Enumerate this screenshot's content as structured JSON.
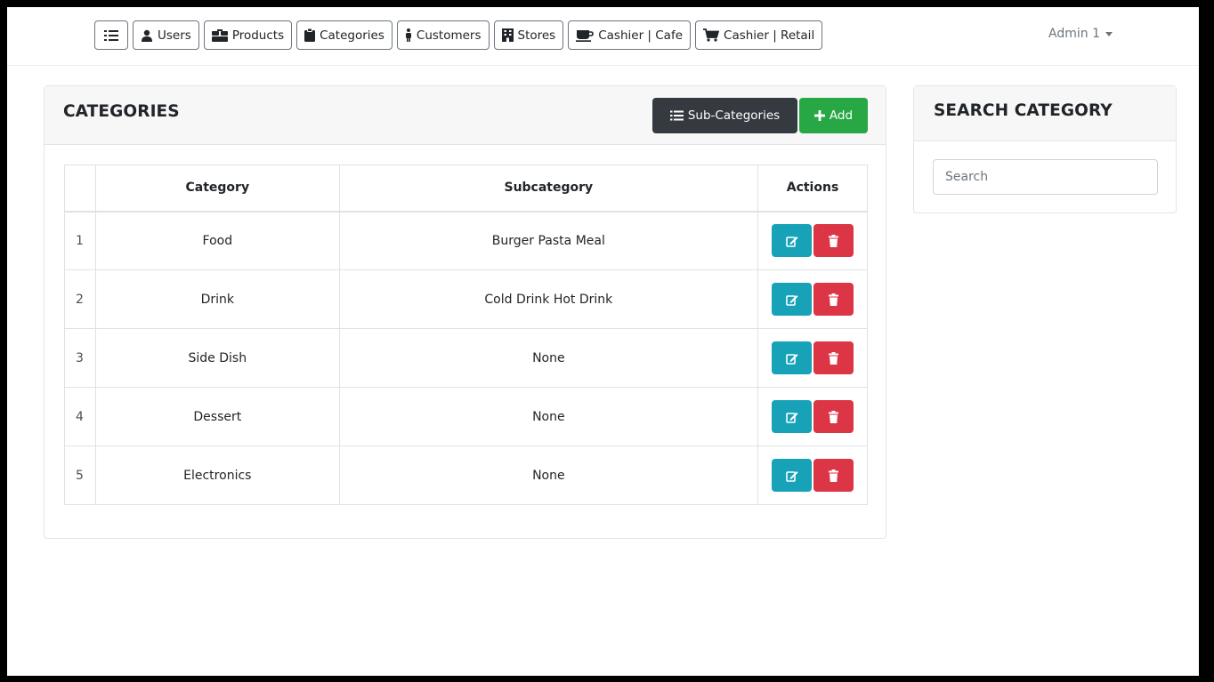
{
  "nav": {
    "items": [
      {
        "label": "Users",
        "icon": "user-icon"
      },
      {
        "label": "Products",
        "icon": "box-icon"
      },
      {
        "label": "Categories",
        "icon": "clipboard-icon"
      },
      {
        "label": "Customers",
        "icon": "person-icon"
      },
      {
        "label": "Stores",
        "icon": "building-icon"
      },
      {
        "label": "Cashier | Cafe",
        "icon": "coffee-cup-icon"
      },
      {
        "label": "Cashier | Retail",
        "icon": "cart-icon"
      }
    ],
    "admin_label": "Admin 1"
  },
  "categories_card": {
    "title": "CATEGORIES",
    "subcategories_button": "Sub-Categories",
    "add_button": "Add"
  },
  "table": {
    "headers": [
      "",
      "Category",
      "Subcategory",
      "Actions"
    ],
    "rows": [
      {
        "index": "1",
        "category": "Food",
        "subcategory": "Burger Pasta Meal"
      },
      {
        "index": "2",
        "category": "Drink",
        "subcategory": "Cold Drink Hot Drink"
      },
      {
        "index": "3",
        "category": "Side Dish",
        "subcategory": "None"
      },
      {
        "index": "4",
        "category": "Dessert",
        "subcategory": "None"
      },
      {
        "index": "5",
        "category": "Electronics",
        "subcategory": "None"
      }
    ]
  },
  "search_card": {
    "title": "SEARCH CATEGORY",
    "placeholder": "Search",
    "value": ""
  },
  "colors": {
    "dark_button": "#343a40",
    "add_button": "#28a745",
    "edit_button": "#17a2b8",
    "delete_button": "#dc3545"
  }
}
